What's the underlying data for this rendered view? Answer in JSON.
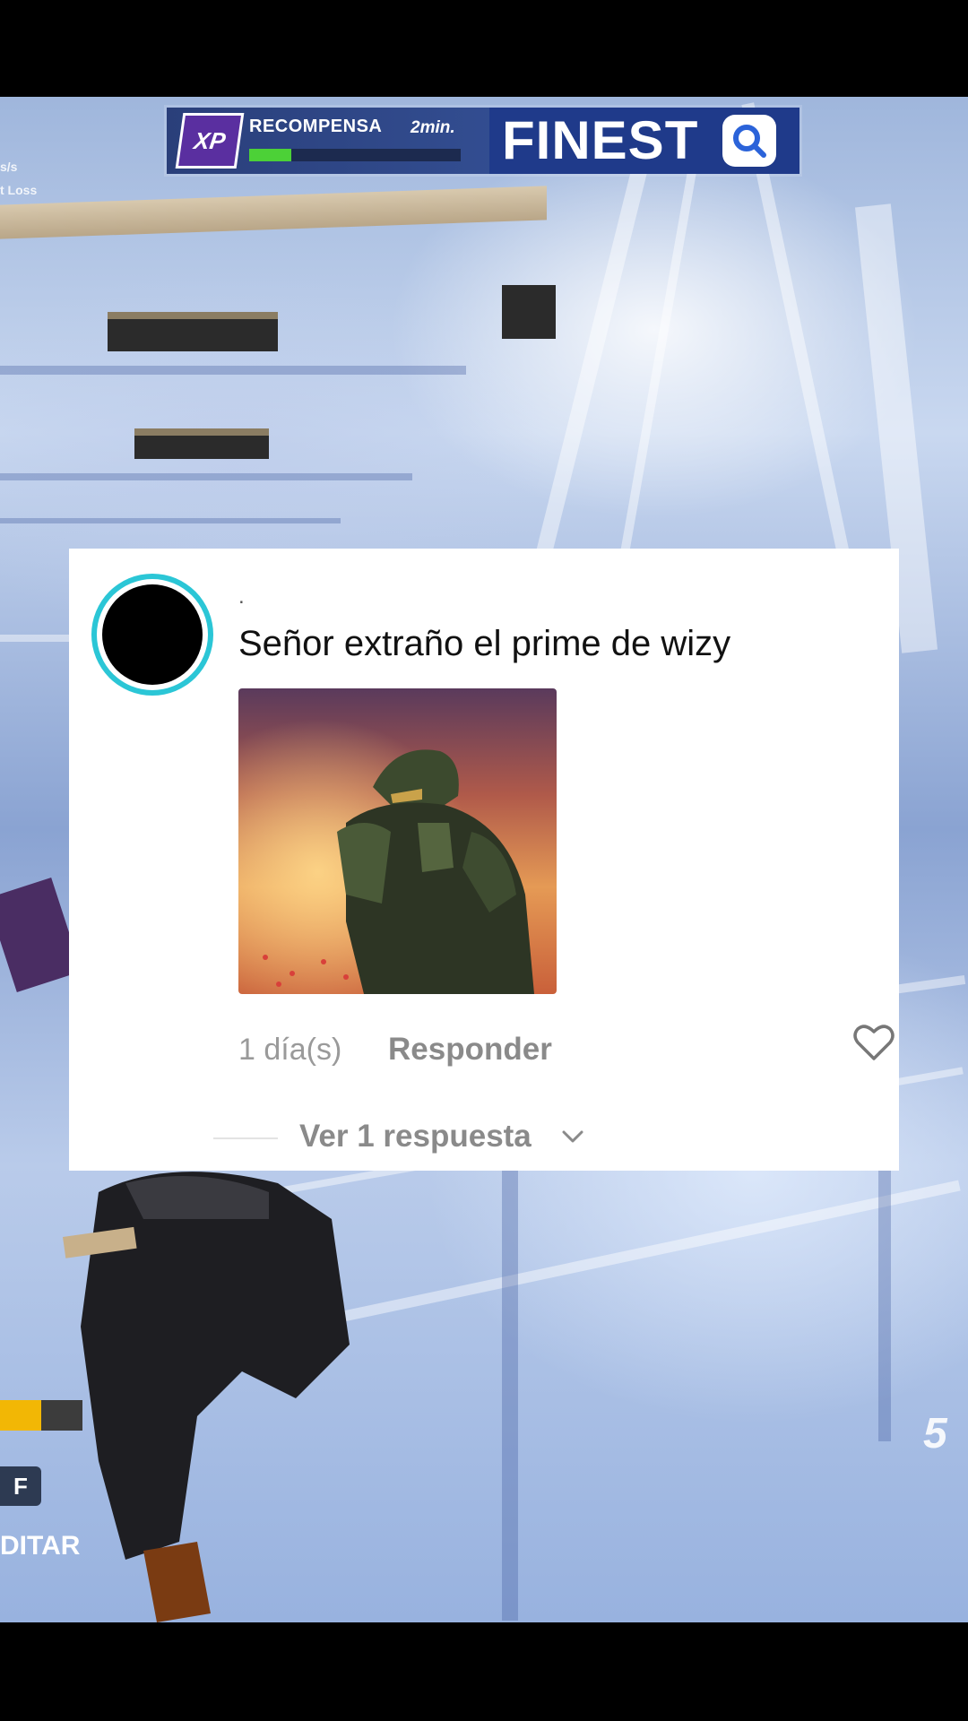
{
  "hud": {
    "xp_badge": "XP",
    "reward_label": "RECOMPENSA",
    "reward_time": "2min.",
    "reward_progress": 0.2,
    "brand_text": "FINEST",
    "brand_icon": "magnifier-icon",
    "side_stat_1": "s/s",
    "side_stat_2": "t Loss",
    "key_hint": "F",
    "edit_label": "DITAR",
    "right_number": "5",
    "health_fraction": 0.5
  },
  "comment": {
    "username": ".",
    "text": "Señor extraño el prime de wizy",
    "age": "1 día(s)",
    "reply_label": "Responder",
    "view_replies_label": "Ver 1 respuesta",
    "like_icon": "heart-outline-icon",
    "expand_icon": "chevron-down-icon",
    "avatar_ring_color": "#2bc6d6"
  }
}
